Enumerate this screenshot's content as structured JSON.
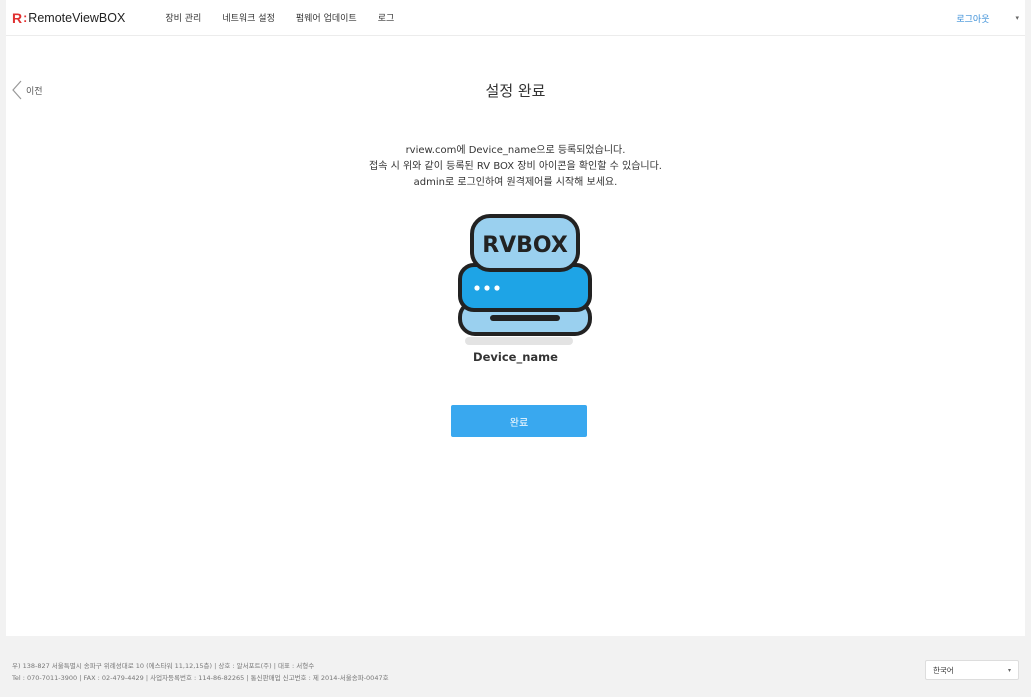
{
  "header": {
    "logo_mark": "R",
    "logo_colon": ":",
    "logo_text": "RemoteViewBOX",
    "nav": [
      "장비 관리",
      "네트워크 설정",
      "펌웨어 업데이트",
      "로그"
    ],
    "logout": "로그아웃",
    "caret": "▾"
  },
  "content": {
    "back_label": "이전",
    "title": "설정 완료",
    "message_lines": [
      "rview.com에 Device_name으로 등록되었습니다.",
      "접속 시 위와 같이 등록된 RV BOX 장비 아이콘을 확인할 수 있습니다.",
      "admin로 로그인하여 원격제어를 시작해 보세요."
    ],
    "icon_label": "RVBOX",
    "device_name": "Device_name",
    "done_button": "완료"
  },
  "footer": {
    "line1": "우) 138-827 서울특별시 송파구 위례성대로 10 (에스타워 11,12,15층) | 상호 : 알서포트(주) | 대표 : 서형수",
    "line2": "Tel : 070-7011-3900 | FAX : 02-479-4429 | 사업자등록번호 : 114-86-82265 | 통신판매업 신고번호 : 제 2014-서울송파-0047호",
    "language": "한국어",
    "language_caret": "▾"
  },
  "colors": {
    "accent": "#39a8ef",
    "logo_red": "#e03131",
    "link": "#3b8fd8"
  }
}
